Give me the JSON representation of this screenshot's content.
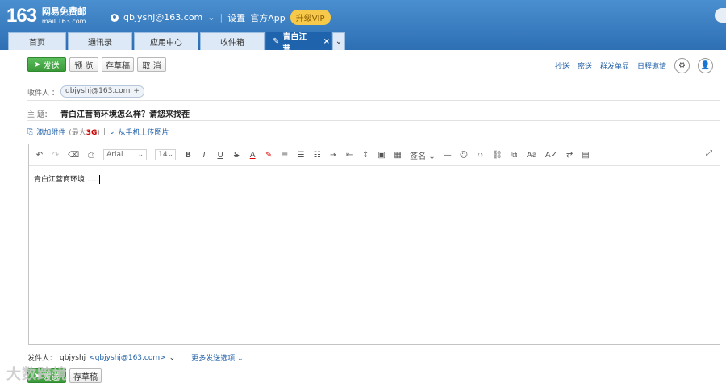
{
  "brand": {
    "logo_number": "163",
    "logo_name": "网易免费邮",
    "logo_domain": "mail.163.com"
  },
  "header": {
    "user_email": "qbjyshj@163.com",
    "settings": "设置",
    "app": "官方App",
    "vip": "升级VIP"
  },
  "tabs": [
    {
      "label": "首页"
    },
    {
      "label": "通讯录"
    },
    {
      "label": "应用中心"
    },
    {
      "label": "收件箱"
    },
    {
      "label": "青白江营..."
    }
  ],
  "compose_toolbar": {
    "send": "发送",
    "preview": "预 览",
    "draft": "存草稿",
    "cancel": "取 消"
  },
  "right_links": [
    "抄送",
    "密送",
    "群发单显",
    "日程邀请"
  ],
  "recipients": {
    "label": "收件人 ：",
    "chip": "qbjyshj@163.com"
  },
  "subject": {
    "label": "主  题：",
    "value": "青白江营商环境怎么样？请您来找茬"
  },
  "attachments": {
    "add": "添加附件",
    "limit_prefix": "(最大",
    "limit_size": "3G",
    "limit_suffix": ")",
    "upload_phone": "从手机上传图片"
  },
  "editor": {
    "font": "Arial",
    "size": "14",
    "signature": "签名",
    "body": "青白江营商环境......"
  },
  "sender": {
    "label": "发件人：",
    "name": "qbjyshj",
    "email": "<qbjyshj@163.com>",
    "more": "更多发送选项"
  },
  "watermark": "大数跨境"
}
